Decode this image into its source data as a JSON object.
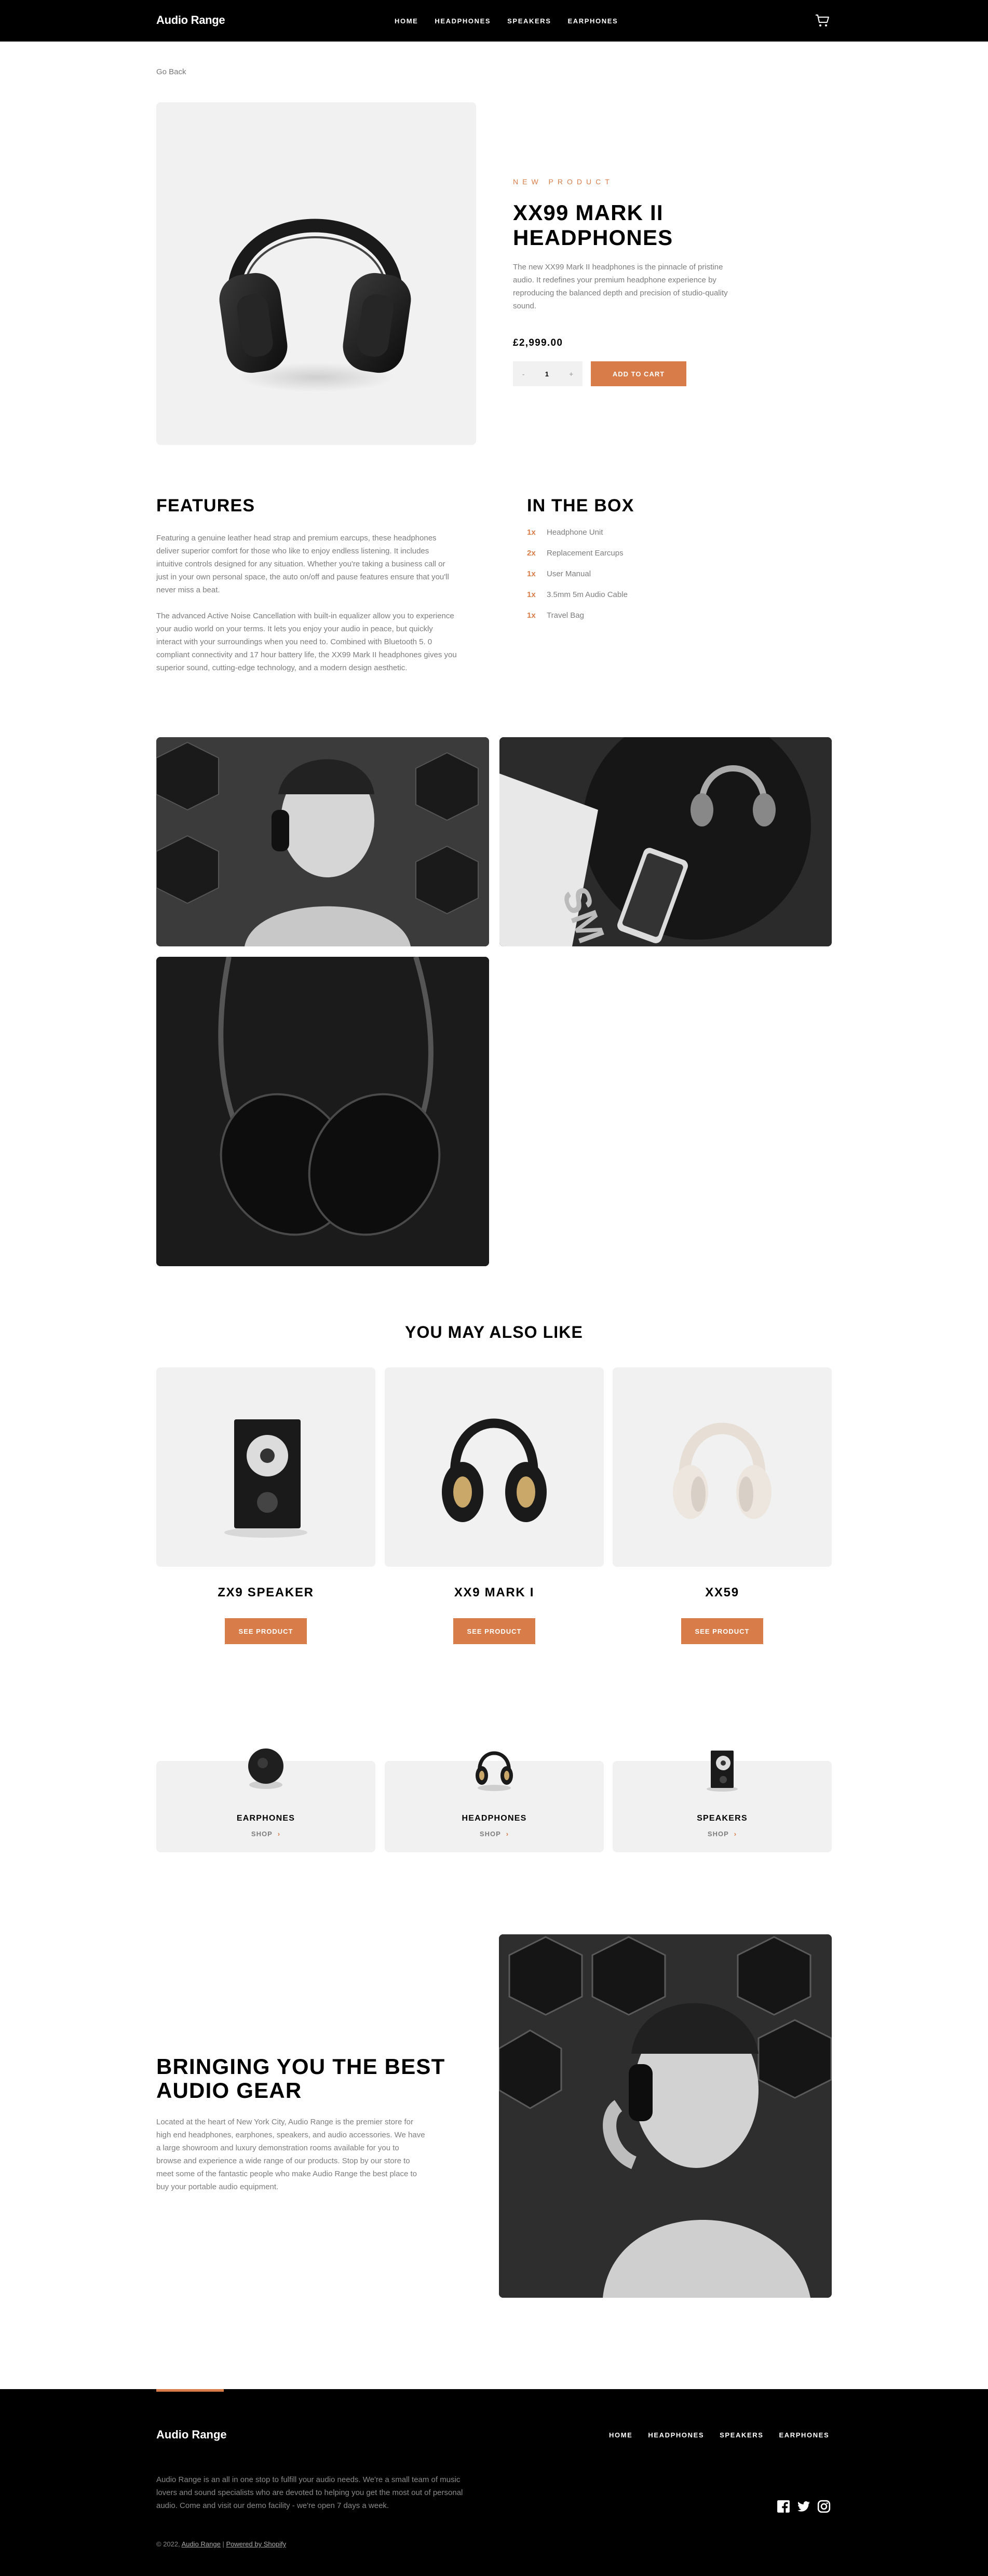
{
  "header": {
    "logo": "Audio Range",
    "nav": [
      "HOME",
      "HEADPHONES",
      "SPEAKERS",
      "EARPHONES"
    ],
    "cart_icon": "cart-icon"
  },
  "go_back": "Go Back",
  "product": {
    "eyebrow": "NEW PRODUCT",
    "title": "XX99 MARK II HEADPHONES",
    "description": "The new XX99 Mark II headphones is the pinnacle of pristine audio. It redefines your premium headphone experience by reproducing the balanced depth and precision of studio-quality sound.",
    "price": "£2,999.00",
    "quantity": "1",
    "minus": "-",
    "plus": "+",
    "add_to_cart": "ADD TO CART"
  },
  "features": {
    "heading": "FEATURES",
    "paragraphs": [
      "Featuring a genuine leather head strap and premium earcups, these headphones deliver superior comfort for those who like to enjoy endless listening. It includes intuitive controls designed for any situation. Whether you're taking a business call or just in your own personal space, the auto on/off and pause features ensure that you'll never miss a beat.",
      "The advanced Active Noise Cancellation with built-in equalizer allow you to experience your audio world on your terms. It lets you enjoy your audio in peace, but quickly interact with your surroundings when you need to. Combined with Bluetooth 5. 0 compliant connectivity and 17 hour battery life, the XX99 Mark II headphones gives you superior sound, cutting-edge technology, and a modern design aesthetic."
    ]
  },
  "in_the_box": {
    "heading": "IN THE BOX",
    "items": [
      {
        "qty": "1x",
        "name": "Headphone Unit"
      },
      {
        "qty": "2x",
        "name": "Replacement Earcups"
      },
      {
        "qty": "1x",
        "name": "User Manual"
      },
      {
        "qty": "1x",
        "name": "3.5mm 5m Audio Cable"
      },
      {
        "qty": "1x",
        "name": "Travel Bag"
      }
    ]
  },
  "may_also_like": {
    "heading": "YOU MAY ALSO LIKE",
    "items": [
      {
        "name": "ZX9 SPEAKER",
        "button": "SEE PRODUCT"
      },
      {
        "name": "XX9 MARK I",
        "button": "SEE PRODUCT"
      },
      {
        "name": "XX59",
        "button": "SEE PRODUCT"
      }
    ]
  },
  "categories": [
    {
      "name": "EARPHONES",
      "shop": "SHOP",
      "chevron": "›"
    },
    {
      "name": "HEADPHONES",
      "shop": "SHOP",
      "chevron": "›"
    },
    {
      "name": "SPEAKERS",
      "shop": "SHOP",
      "chevron": "›"
    }
  ],
  "best_gear": {
    "heading": "BRINGING YOU THE BEST AUDIO GEAR",
    "text": "Located at the heart of New York City, Audio Range is the premier store for high end headphones, earphones, speakers, and audio accessories. We have a large showroom and luxury demonstration rooms available for you to browse and experience a wide range of our products. Stop by our store to meet some of the fantastic people who make Audio Range the best place to buy your portable audio equipment."
  },
  "footer": {
    "logo": "Audio Range",
    "nav": [
      "HOME",
      "HEADPHONES",
      "SPEAKERS",
      "EARPHONES"
    ],
    "description": "Audio Range is an all in one stop to fulfill your audio needs. We're a small team of music lovers and sound specialists who are devoted to helping you get the most out of personal audio. Come and visit our demo facility - we're open 7 days a week.",
    "copyright": "© 2022,",
    "store_link": "Audio Range",
    "separator": "|",
    "powered": "Powered by Shopify",
    "social": [
      "facebook-icon",
      "twitter-icon",
      "instagram-icon"
    ]
  },
  "colors": {
    "accent": "#d87d4a",
    "dark": "#000000",
    "light_bg": "#f1f1f1",
    "muted_text": "#7d7d7d"
  }
}
